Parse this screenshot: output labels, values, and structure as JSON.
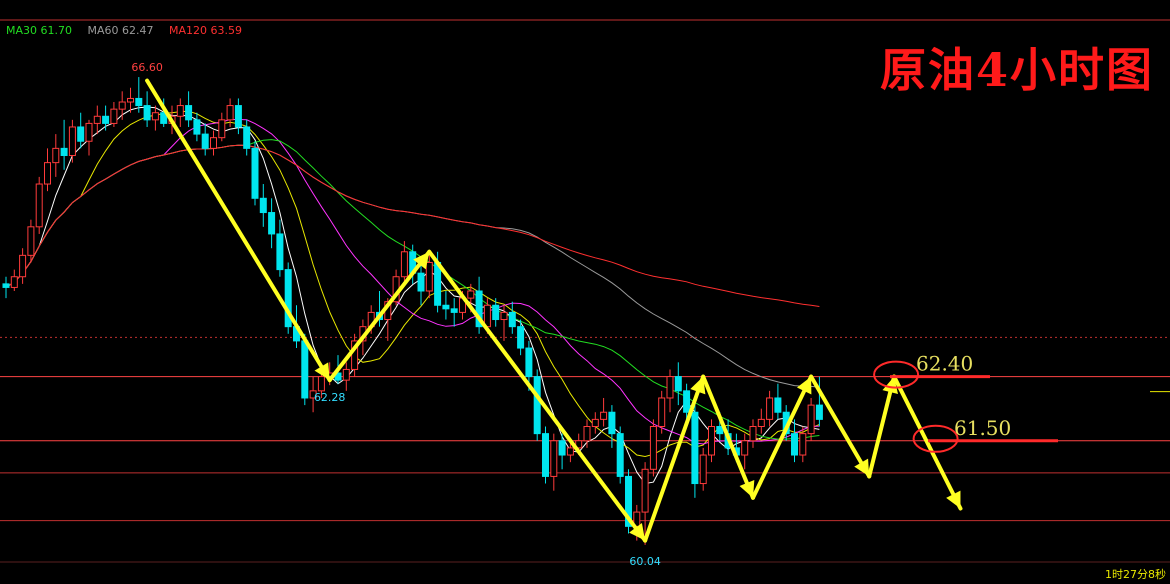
{
  "legend": [
    {
      "label": "MA30 61.70",
      "color": "#22dd22"
    },
    {
      "label": "MA60 62.47",
      "color": "#9a9a9a"
    },
    {
      "label": "MA120 63.59",
      "color": "#ff3030"
    }
  ],
  "title": "原油4小时图",
  "timer_text": "1时27分8秒",
  "colors": {
    "up": "#ff3b3b",
    "down": "#00e5ee",
    "arrow": "#ffff22",
    "level": "#ff4444",
    "annot_level": "#e8e060"
  },
  "chart_data": {
    "type": "candlestick",
    "title": "原油4小时图",
    "ylim": [
      59.8,
      67.4
    ],
    "moving_averages": [
      {
        "name": "MA30",
        "value": 61.7
      },
      {
        "name": "MA60",
        "value": 62.47
      },
      {
        "name": "MA120",
        "value": 63.59
      }
    ],
    "price_labels": [
      {
        "text": "66.60",
        "value": 66.6,
        "index": 17
      },
      {
        "text": "62.28",
        "value": 62.28,
        "index": 39
      },
      {
        "text": "60.04",
        "value": 60.04,
        "index": 77
      }
    ],
    "levels": [
      {
        "text": "62.40",
        "value": 62.4
      },
      {
        "text": "61.50",
        "value": 61.5
      }
    ],
    "extra_horizontal_levels": [
      62.95,
      61.05,
      60.38
    ],
    "candles": [
      [
        63.7,
        63.8,
        63.5,
        63.65
      ],
      [
        63.65,
        63.9,
        63.6,
        63.8
      ],
      [
        63.8,
        64.2,
        63.7,
        64.1
      ],
      [
        64.1,
        64.6,
        64.0,
        64.5
      ],
      [
        64.5,
        65.2,
        64.4,
        65.1
      ],
      [
        65.1,
        65.6,
        65.0,
        65.4
      ],
      [
        65.4,
        65.8,
        65.2,
        65.6
      ],
      [
        65.6,
        66.0,
        65.3,
        65.5
      ],
      [
        65.5,
        66.0,
        65.4,
        65.9
      ],
      [
        65.9,
        66.1,
        65.6,
        65.7
      ],
      [
        65.7,
        66.0,
        65.5,
        65.95
      ],
      [
        65.95,
        66.2,
        65.8,
        66.05
      ],
      [
        66.05,
        66.2,
        65.85,
        65.95
      ],
      [
        65.95,
        66.25,
        65.9,
        66.15
      ],
      [
        66.15,
        66.4,
        66.0,
        66.25
      ],
      [
        66.25,
        66.45,
        66.1,
        66.3
      ],
      [
        66.3,
        66.6,
        66.1,
        66.2
      ],
      [
        66.2,
        66.4,
        65.9,
        66.0
      ],
      [
        66.0,
        66.2,
        65.85,
        66.1
      ],
      [
        66.1,
        66.3,
        65.9,
        65.95
      ],
      [
        65.95,
        66.2,
        65.8,
        66.05
      ],
      [
        66.05,
        66.3,
        65.9,
        66.2
      ],
      [
        66.2,
        66.4,
        65.9,
        66.0
      ],
      [
        66.0,
        66.1,
        65.7,
        65.8
      ],
      [
        65.8,
        65.95,
        65.5,
        65.6
      ],
      [
        65.6,
        65.85,
        65.5,
        65.75
      ],
      [
        65.75,
        66.1,
        65.7,
        66.0
      ],
      [
        66.0,
        66.3,
        65.9,
        66.2
      ],
      [
        66.2,
        66.3,
        65.8,
        65.9
      ],
      [
        65.9,
        66.0,
        65.5,
        65.6
      ],
      [
        65.6,
        65.7,
        64.8,
        64.9
      ],
      [
        64.9,
        65.1,
        64.5,
        64.7
      ],
      [
        64.7,
        64.9,
        64.2,
        64.4
      ],
      [
        64.4,
        64.6,
        63.8,
        63.9
      ],
      [
        63.9,
        64.0,
        63.0,
        63.1
      ],
      [
        63.1,
        63.4,
        62.8,
        62.9
      ],
      [
        62.9,
        63.0,
        62.0,
        62.1
      ],
      [
        62.1,
        62.4,
        61.9,
        62.2
      ],
      [
        62.2,
        62.5,
        62.1,
        62.4
      ],
      [
        62.4,
        62.6,
        62.28,
        62.45
      ],
      [
        62.45,
        62.7,
        62.3,
        62.35
      ],
      [
        62.35,
        62.6,
        62.2,
        62.5
      ],
      [
        62.5,
        63.0,
        62.4,
        62.9
      ],
      [
        62.9,
        63.2,
        62.7,
        63.1
      ],
      [
        63.1,
        63.4,
        63.0,
        63.3
      ],
      [
        63.3,
        63.6,
        63.1,
        63.2
      ],
      [
        63.2,
        63.5,
        62.9,
        63.45
      ],
      [
        63.45,
        63.9,
        63.4,
        63.8
      ],
      [
        63.8,
        64.3,
        63.7,
        64.15
      ],
      [
        64.15,
        64.25,
        63.7,
        63.85
      ],
      [
        63.85,
        64.0,
        63.4,
        63.6
      ],
      [
        63.6,
        64.1,
        63.5,
        64.0
      ],
      [
        64.0,
        64.15,
        63.3,
        63.4
      ],
      [
        63.4,
        63.6,
        63.2,
        63.35
      ],
      [
        63.35,
        63.5,
        63.1,
        63.3
      ],
      [
        63.3,
        63.6,
        63.2,
        63.5
      ],
      [
        63.5,
        63.7,
        63.3,
        63.6
      ],
      [
        63.6,
        63.8,
        63.0,
        63.1
      ],
      [
        63.1,
        63.5,
        63.0,
        63.4
      ],
      [
        63.4,
        63.5,
        63.1,
        63.2
      ],
      [
        63.2,
        63.4,
        62.9,
        63.3
      ],
      [
        63.3,
        63.45,
        63.0,
        63.1
      ],
      [
        63.1,
        63.2,
        62.7,
        62.8
      ],
      [
        62.8,
        62.9,
        62.2,
        62.4
      ],
      [
        62.4,
        62.5,
        61.5,
        61.6
      ],
      [
        61.6,
        61.7,
        60.9,
        61.0
      ],
      [
        61.0,
        61.6,
        60.8,
        61.5
      ],
      [
        61.5,
        61.6,
        61.1,
        61.3
      ],
      [
        61.3,
        61.5,
        61.2,
        61.4
      ],
      [
        61.4,
        61.6,
        61.3,
        61.5
      ],
      [
        61.5,
        61.8,
        61.4,
        61.7
      ],
      [
        61.7,
        61.9,
        61.6,
        61.8
      ],
      [
        61.8,
        62.1,
        61.7,
        61.9
      ],
      [
        61.9,
        62.0,
        61.4,
        61.6
      ],
      [
        61.6,
        61.7,
        60.9,
        61.0
      ],
      [
        61.0,
        61.1,
        60.2,
        60.3
      ],
      [
        60.3,
        60.6,
        60.1,
        60.5
      ],
      [
        60.5,
        61.2,
        60.04,
        61.1
      ],
      [
        61.1,
        61.8,
        61.0,
        61.7
      ],
      [
        61.7,
        62.2,
        61.6,
        62.1
      ],
      [
        62.1,
        62.5,
        61.9,
        62.4
      ],
      [
        62.4,
        62.6,
        62.0,
        62.2
      ],
      [
        62.2,
        62.3,
        61.8,
        61.9
      ],
      [
        61.9,
        62.1,
        60.7,
        60.9
      ],
      [
        60.9,
        61.4,
        60.8,
        61.3
      ],
      [
        61.3,
        61.8,
        61.2,
        61.7
      ],
      [
        61.7,
        61.9,
        61.5,
        61.6
      ],
      [
        61.6,
        61.8,
        61.3,
        61.4
      ],
      [
        61.4,
        61.6,
        61.2,
        61.3
      ],
      [
        61.3,
        61.6,
        61.1,
        61.5
      ],
      [
        61.5,
        61.8,
        61.4,
        61.7
      ],
      [
        61.7,
        61.95,
        61.6,
        61.8
      ],
      [
        61.8,
        62.2,
        61.7,
        62.1
      ],
      [
        62.1,
        62.3,
        61.8,
        61.9
      ],
      [
        61.9,
        62.0,
        61.5,
        61.6
      ],
      [
        61.6,
        61.8,
        61.2,
        61.3
      ],
      [
        61.3,
        61.7,
        61.2,
        61.6
      ],
      [
        61.6,
        62.1,
        61.5,
        62.0
      ],
      [
        62.0,
        62.4,
        61.7,
        61.8
      ]
    ],
    "wave_arrows": [
      [
        [
          17,
          66.55
        ],
        [
          39,
          62.35
        ]
      ],
      [
        [
          39,
          62.35
        ],
        [
          51,
          64.15
        ]
      ],
      [
        [
          51,
          64.15
        ],
        [
          77,
          60.1
        ]
      ],
      [
        [
          77,
          60.1
        ],
        [
          84,
          62.4
        ]
      ],
      [
        [
          84,
          62.4
        ],
        [
          90,
          60.7
        ]
      ],
      [
        [
          90,
          60.7
        ],
        [
          97,
          62.4
        ]
      ],
      [
        [
          97,
          62.4
        ],
        [
          104,
          61.0
        ]
      ],
      [
        [
          104,
          61.0
        ],
        [
          107,
          62.4
        ]
      ],
      [
        [
          107,
          62.4
        ],
        [
          115,
          60.55
        ]
      ]
    ],
    "circles": [
      62.4,
      61.5
    ]
  }
}
